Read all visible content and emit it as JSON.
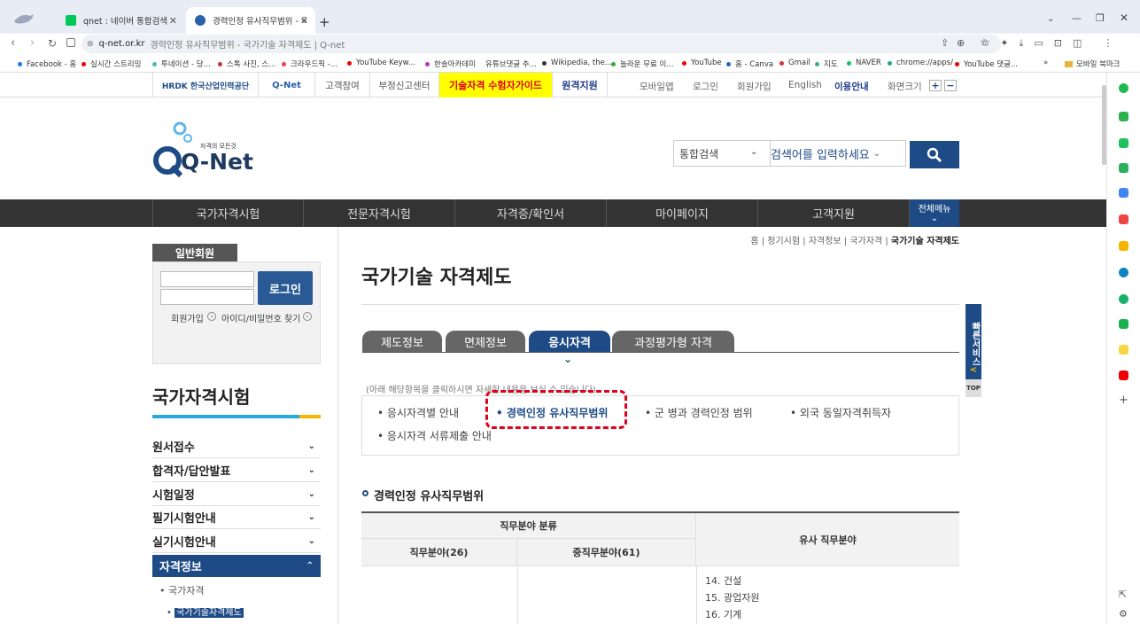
{
  "browser": {
    "tabs": [
      {
        "title": "qnet : 네이버 통합검색",
        "icon": "naver-icon"
      },
      {
        "title": "경력인정 유사직무범위 - 국가기",
        "icon": "qnet-icon"
      }
    ],
    "new_tab": "+",
    "url_domain": "q-net.or.kr",
    "url_rest": "경력인정 유사직무범위 - 국가기술 자격제도 | Q-net",
    "bookmarks": [
      "Facebook - 홈",
      "실시간 스트리밍",
      "투네이션 - 당...",
      "스톡 사진, 스...",
      "크라우드픽 -...",
      "YouTube Keyw...",
      "한솔아카데미",
      "유튜브댓글 추...",
      "Wikipedia, the...",
      "놀라운 무료 이...",
      "YouTube",
      "홈 - Canva",
      "Gmail",
      "지도",
      "NAVER",
      "chrome://apps/",
      "YouTube 댓글..."
    ],
    "bookmarks_more": "»",
    "mobile_bookmarks": "모바일 북마크"
  },
  "util": {
    "hrdk": "HRDK 한국산업인력공단",
    "qnet": "Q-Net",
    "links_left": [
      "고객참여",
      "부정신고센터"
    ],
    "guide": "기술자격 수험자가이드",
    "remote": "원격지원",
    "links_right": [
      "모바일앱",
      "로그인",
      "회원가입",
      "English",
      "이용안내",
      "화면크기"
    ],
    "zoom_plus": "+",
    "zoom_minus": "−"
  },
  "header": {
    "logo_small": "자격의 모든것",
    "logo_main": "Q-Net",
    "search_scope": "통합검색",
    "search_placeholder": "검색어를 입력하세요"
  },
  "nav": {
    "items": [
      "국가자격시험",
      "전문자격시험",
      "자격증/확인서",
      "마이페이지",
      "고객지원"
    ],
    "all_menu": "전체메뉴"
  },
  "login": {
    "tab": "일반회원",
    "button": "로그인",
    "join": "회원가입",
    "find": "아이디/비밀번호 찾기"
  },
  "sidebar": {
    "title": "국가자격시험",
    "menus": [
      "원서접수",
      "합격자/답안발표",
      "시험일정",
      "필기시험안내",
      "실기시험안내"
    ],
    "active": "자격정보",
    "sub": [
      "국가자격",
      "국가기술자격제도"
    ]
  },
  "breadcrumb": [
    "홈",
    "정기시험",
    "자격정보",
    "국가자격",
    "국가기술 자격제도"
  ],
  "page_title": "국가기술 자격제도",
  "tabs": [
    "제도정보",
    "면제정보",
    "응시자격",
    "과정평가형 자격"
  ],
  "active_tab": 2,
  "notice": "(아래 해당항목을 클릭하시면 자세한 내용을 보실 수 있습니다)",
  "links": [
    "응시자격별 안내",
    "경력인정 유사직무범위",
    "군 병과 경력인정 범위",
    "외국 동일자격취득자",
    "응시자격 서류제출 안내"
  ],
  "quick": {
    "label": "빠른서비스",
    "arrow": "<",
    "top": "TOP"
  },
  "section_title": "경력인정 유사직무범위",
  "table": {
    "h1": "직무분야 분류",
    "h2": "유사 직무분야",
    "sub1": "직무분야(26)",
    "sub2": "중직무분야(61)",
    "rows": [
      "14. 건설",
      "15. 광업자원",
      "16. 기계"
    ]
  },
  "colors": {
    "accent": "#1e4b86",
    "highlight": "#e0001b",
    "guide_bg": "#ffff00"
  }
}
